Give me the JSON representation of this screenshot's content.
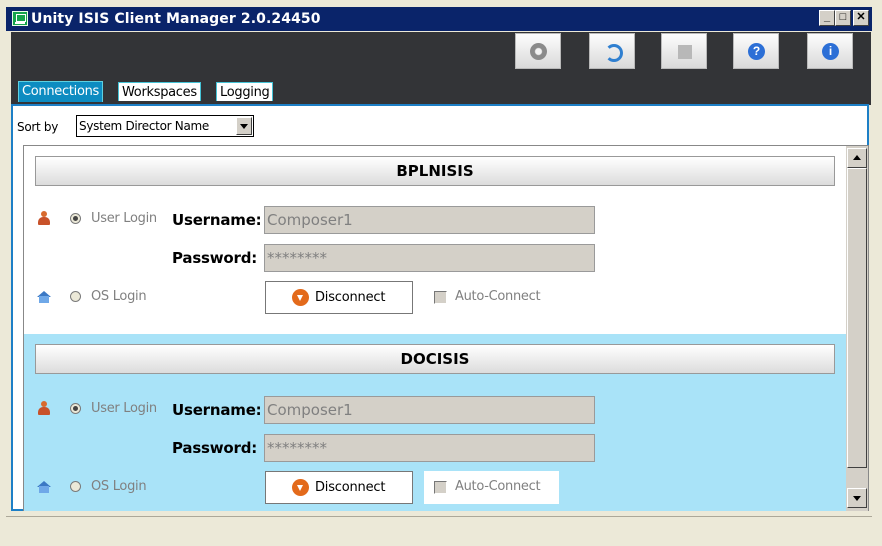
{
  "window": {
    "title": "Unity ISIS Client Manager 2.0.24450"
  },
  "window_controls": {
    "minimize": "_",
    "maximize": "□",
    "close": "✕"
  },
  "toolbar": {
    "buttons": [
      {
        "icon": "gear-icon",
        "color": "#8a8a8a"
      },
      {
        "icon": "refresh-icon",
        "color": "#2f7fd0"
      },
      {
        "icon": "grid-icon",
        "color": "#b0b0b0"
      },
      {
        "icon": "help-icon",
        "color": "#2c6fd6",
        "glyph": "?"
      },
      {
        "icon": "info-icon",
        "color": "#2c6fd6",
        "glyph": "i"
      }
    ]
  },
  "tabs": [
    {
      "label": "Connections",
      "active": true
    },
    {
      "label": "Workspaces",
      "active": false
    },
    {
      "label": "Logging",
      "active": false
    }
  ],
  "sort": {
    "label": "Sort by",
    "value": "System Director Name"
  },
  "connections": [
    {
      "name": "BPLNISIS",
      "background": "#ffffff",
      "user_login_label": "User Login",
      "os_login_label": "OS Login",
      "username_label": "Username:",
      "username_value": "Composer1",
      "password_label": "Password:",
      "password_value": "********",
      "button_label": "Disconnect",
      "auto_connect_label": "Auto-Connect",
      "login_mode": "user"
    },
    {
      "name": "DOCISIS",
      "background": "#a9e3f8",
      "user_login_label": "User Login",
      "os_login_label": "OS Login",
      "username_label": "Username:",
      "username_value": "Composer1",
      "password_label": "Password:",
      "password_value": "********",
      "button_label": "Disconnect",
      "auto_connect_label": "Auto-Connect",
      "login_mode": "user"
    }
  ]
}
